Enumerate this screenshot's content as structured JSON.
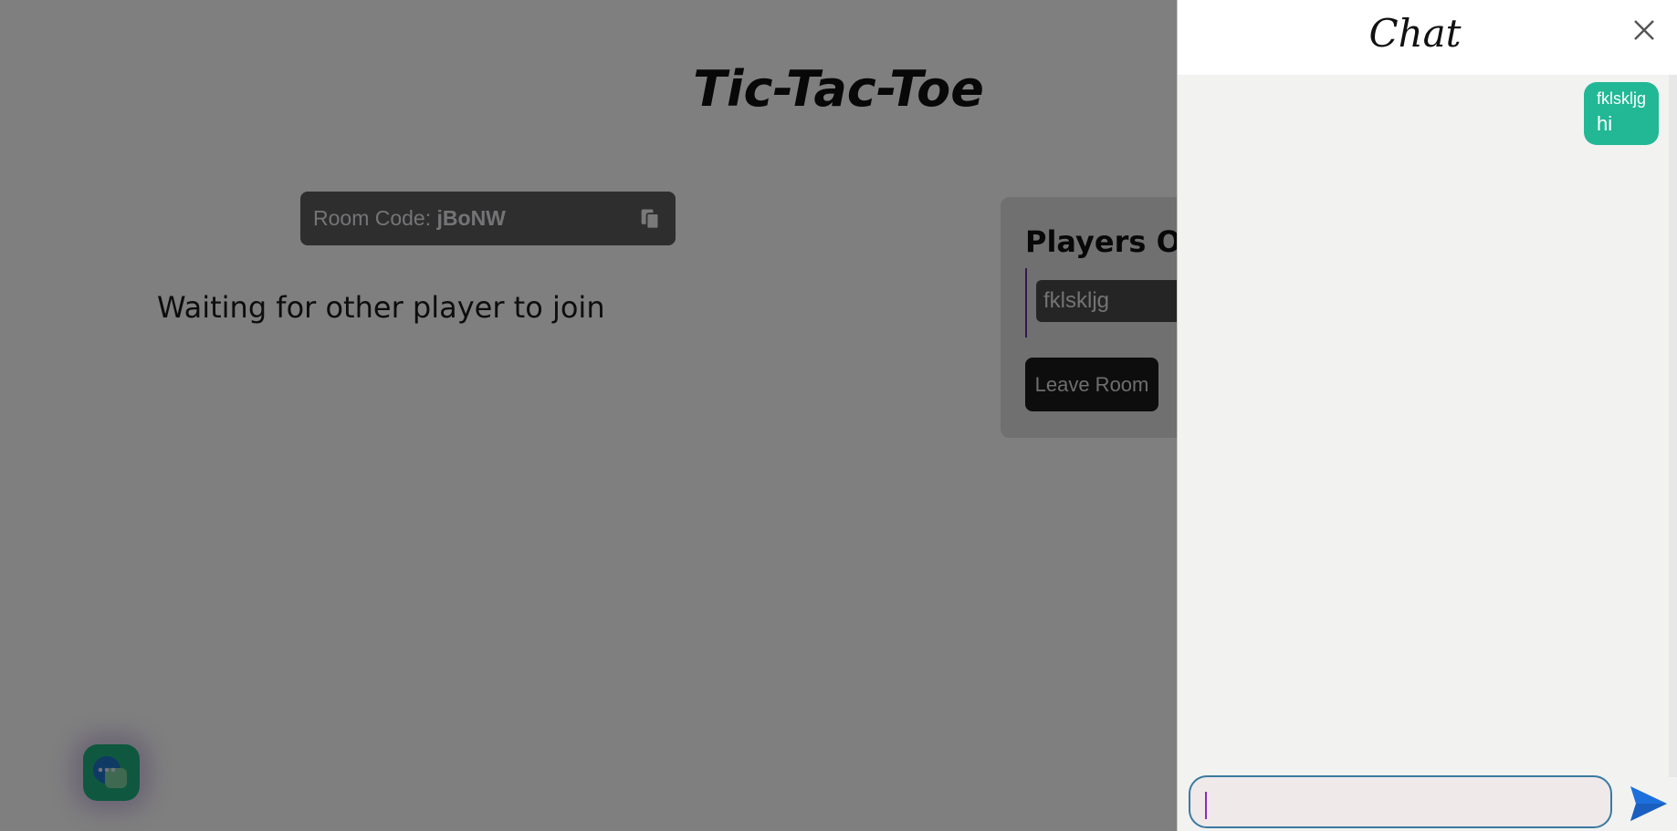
{
  "app": {
    "title": "Tic-Tac-Toe"
  },
  "room": {
    "label": "Room Code:",
    "code": "jBoNW",
    "copy_icon": "copy-icon"
  },
  "status": {
    "waiting_text": "Waiting for other player to join"
  },
  "players_panel": {
    "title": "Players Onl",
    "players": [
      {
        "name": "fklskljg"
      }
    ],
    "leave_label": "Leave Room"
  },
  "chat": {
    "title": "Chat",
    "close_icon": "close-icon",
    "messages": [
      {
        "user": "fklskljg",
        "text": "hi"
      }
    ],
    "input_value": "",
    "send_icon": "send-icon"
  },
  "colors": {
    "accent_green": "#22b896",
    "overlay": "rgba(0,0,0,0.5)",
    "send_blue": "#1d6fdc"
  }
}
